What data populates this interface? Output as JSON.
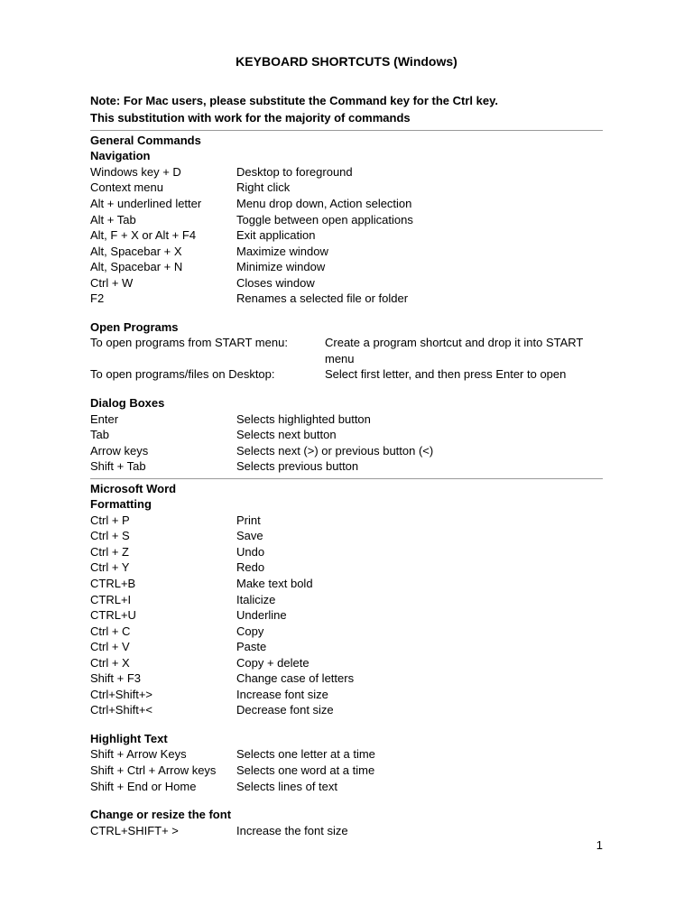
{
  "title": "KEYBOARD SHORTCUTS (Windows)",
  "note_line1": "Note: For Mac users, please substitute the Command key for the Ctrl key.",
  "note_line2": "This substitution with work for the majority of commands",
  "general": {
    "head1": "General Commands",
    "head2": "Navigation",
    "rows": [
      {
        "k": "Windows key + D",
        "v": "Desktop to foreground"
      },
      {
        "k": "Context menu",
        "v": "Right click"
      },
      {
        "k": "Alt + underlined letter",
        "v": "Menu drop down, Action selection"
      },
      {
        "k": "Alt + Tab",
        "v": "Toggle between open applications"
      },
      {
        "k": "Alt, F + X  or Alt + F4",
        "v": "Exit application"
      },
      {
        "k": "Alt, Spacebar + X",
        "v": "Maximize window"
      },
      {
        "k": "Alt, Spacebar + N",
        "v": "Minimize window"
      },
      {
        "k": "Ctrl + W",
        "v": "Closes window"
      },
      {
        "k": "F2",
        "v": "Renames a selected file or folder"
      }
    ]
  },
  "open_programs": {
    "head": "Open Programs",
    "rows": [
      {
        "k": "To open programs from START menu:",
        "v": "Create a program shortcut and drop it into START menu"
      },
      {
        "k": "To open programs/files on Desktop:",
        "v": "Select first letter, and then press Enter to open"
      }
    ]
  },
  "dialog": {
    "head": "Dialog Boxes",
    "rows": [
      {
        "k": "Enter",
        "v": "Selects highlighted button"
      },
      {
        "k": "Tab",
        "v": "Selects next button"
      },
      {
        "k": "Arrow keys",
        "v": "Selects next (>) or previous button (<)"
      },
      {
        "k": "Shift + Tab",
        "v": "Selects previous button"
      }
    ]
  },
  "word": {
    "head1": "Microsoft Word",
    "head2": "Formatting",
    "rows": [
      {
        "k": "Ctrl + P",
        "v": "Print"
      },
      {
        "k": "Ctrl + S",
        "v": "Save"
      },
      {
        "k": "Ctrl + Z",
        "v": "Undo"
      },
      {
        "k": "Ctrl + Y",
        "v": "Redo"
      },
      {
        "k": "CTRL+B",
        "v": "Make text bold"
      },
      {
        "k": "CTRL+I",
        "v": "Italicize"
      },
      {
        "k": "CTRL+U",
        "v": "Underline"
      },
      {
        "k": "Ctrl + C",
        "v": "Copy"
      },
      {
        "k": "Ctrl + V",
        "v": "Paste"
      },
      {
        "k": "Ctrl + X",
        "v": "Copy + delete"
      },
      {
        "k": "Shift + F3",
        "v": "Change case of letters"
      },
      {
        "k": "Ctrl+Shift+>",
        "v": "Increase font size"
      },
      {
        "k": "Ctrl+Shift+<",
        "v": "Decrease font size"
      }
    ]
  },
  "highlight": {
    "head": "Highlight Text",
    "rows": [
      {
        "k": "Shift + Arrow Keys",
        "v": "Selects one letter at a time"
      },
      {
        "k": "Shift + Ctrl + Arrow keys",
        "v": "Selects one word at a time"
      },
      {
        "k": "Shift + End or Home",
        "v": "Selects lines of text"
      }
    ]
  },
  "resize": {
    "head": "Change or resize the font",
    "rows": [
      {
        "k": "CTRL+SHIFT+ >",
        "v": "Increase the font size"
      }
    ]
  },
  "page_number": "1"
}
